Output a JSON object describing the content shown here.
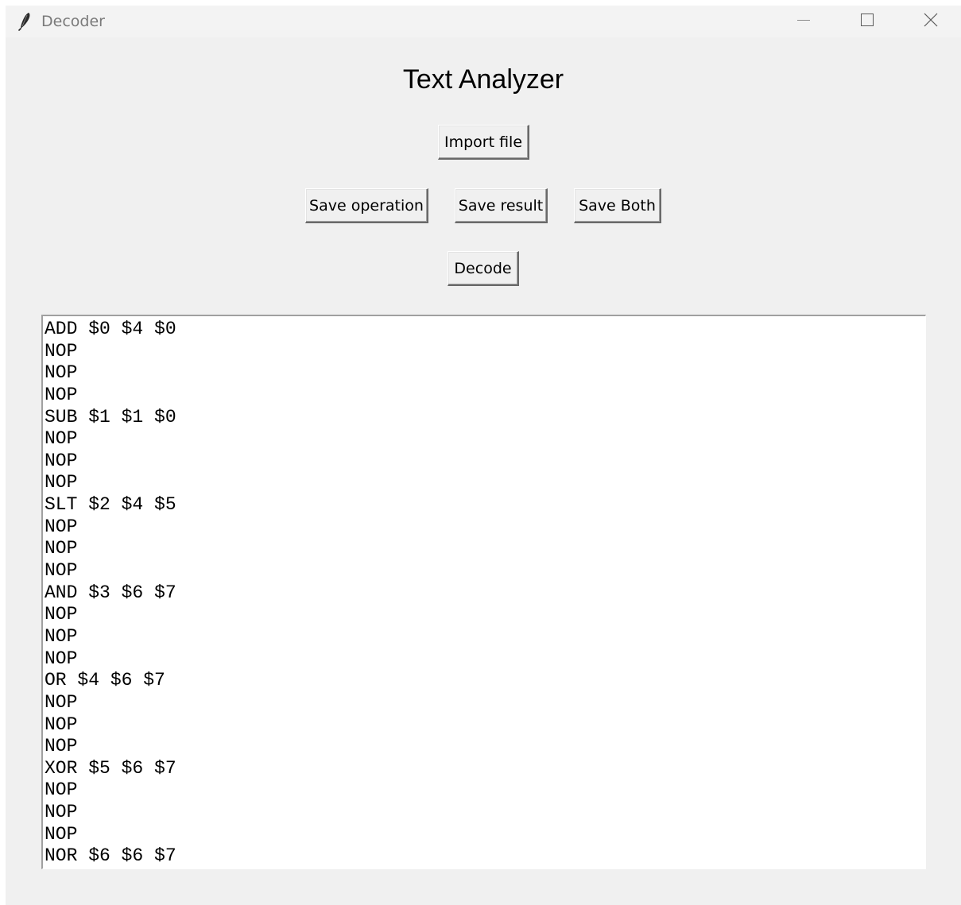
{
  "window": {
    "title": "Decoder",
    "icon": "feather-icon",
    "controls": {
      "minimize_icon": "minimize-icon",
      "maximize_icon": "maximize-icon",
      "close_icon": "close-icon"
    }
  },
  "main": {
    "heading": "Text Analyzer",
    "buttons": {
      "import_file": "Import file",
      "save_operation": "Save operation",
      "save_result": "Save result",
      "save_both": "Save Both",
      "decode": "Decode"
    },
    "text_lines": [
      "ADD $0 $4 $0",
      "NOP",
      "NOP",
      "NOP",
      "SUB $1 $1 $0",
      "NOP",
      "NOP",
      "NOP",
      "SLT $2 $4 $5",
      "NOP",
      "NOP",
      "NOP",
      "AND $3 $6 $7",
      "NOP",
      "NOP",
      "NOP",
      "OR $4 $6 $7",
      "NOP",
      "NOP",
      "NOP",
      "XOR $5 $6 $7",
      "NOP",
      "NOP",
      "NOP",
      "NOR $6 $6 $7"
    ]
  },
  "colors": {
    "window_background": "#f0f0f0",
    "titlebar_background": "#f3f3f3",
    "title_text": "#7a7a7a",
    "text_area_background": "#ffffff"
  }
}
